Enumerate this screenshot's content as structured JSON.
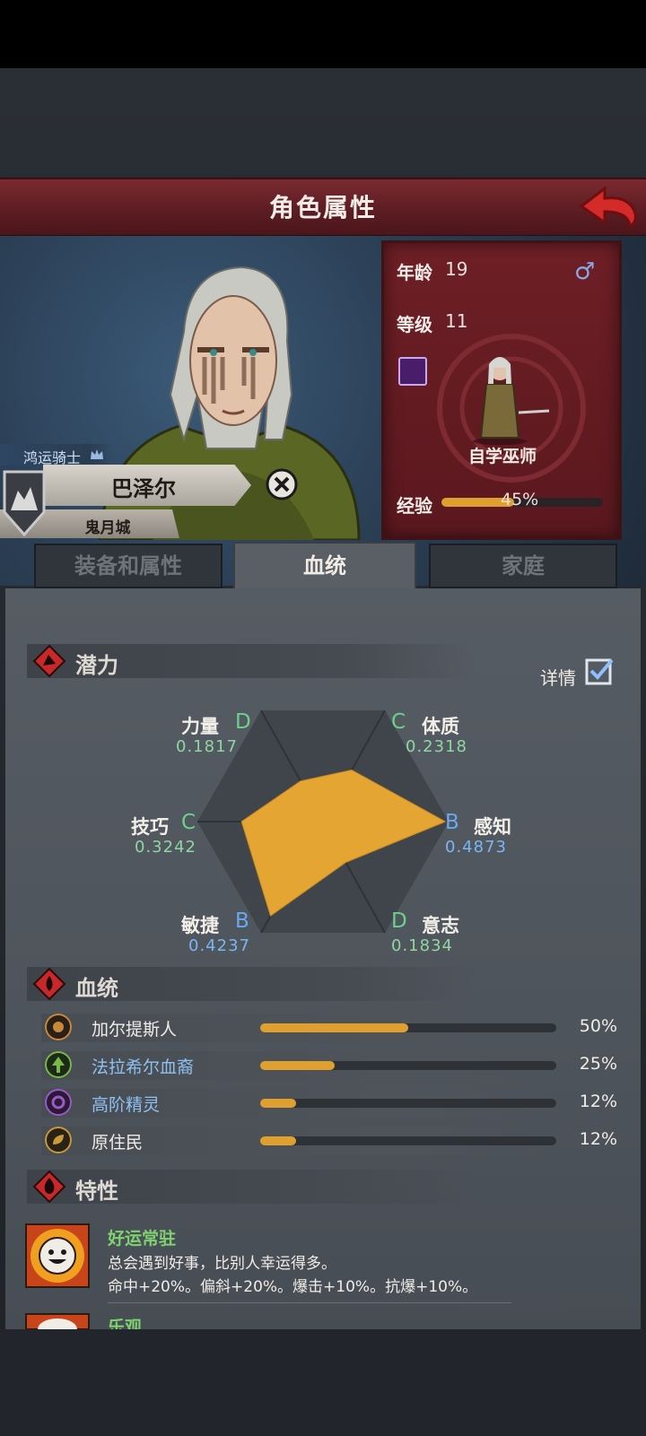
{
  "header": {
    "title": "角色属性",
    "back_icon": "red-arrow-back-icon"
  },
  "character": {
    "title": "鸿运骑士",
    "name": "巴泽尔",
    "city": "鬼月城",
    "age_label": "年龄",
    "age": "19",
    "level_label": "等级",
    "level": "11",
    "class_name": "自学巫师",
    "exp_label": "经验",
    "exp_percent": 45,
    "exp_text": "45%",
    "gender_icon": "male-icon"
  },
  "tabs": [
    {
      "label": "装备和属性",
      "active": false
    },
    {
      "label": "血统",
      "active": true
    },
    {
      "label": "家庭",
      "active": false
    }
  ],
  "potential": {
    "title": "潜力",
    "detail_label": "详情",
    "detail_checked": true,
    "attributes": [
      {
        "name": "力量",
        "grade": "D",
        "value": "0.1817"
      },
      {
        "name": "体质",
        "grade": "C",
        "value": "0.2318"
      },
      {
        "name": "感知",
        "grade": "B",
        "value": "0.4873"
      },
      {
        "name": "意志",
        "grade": "D",
        "value": "0.1834"
      },
      {
        "name": "敏捷",
        "grade": "B",
        "value": "0.4237"
      },
      {
        "name": "技巧",
        "grade": "C",
        "value": "0.3242"
      }
    ],
    "chart_data": {
      "type": "radar",
      "axes": [
        "力量",
        "体质",
        "感知",
        "意志",
        "敏捷",
        "技巧"
      ],
      "values": [
        0.1817,
        0.2318,
        0.4873,
        0.1834,
        0.4237,
        0.3242
      ],
      "max": 0.5,
      "fill_color": "#e5a533"
    }
  },
  "bloodline": {
    "title": "血统",
    "items": [
      {
        "name": "加尔提斯人",
        "percent": 50,
        "text": "50%",
        "color": "#c8893a"
      },
      {
        "name": "法拉希尔血裔",
        "percent": 25,
        "text": "25%",
        "color": "#7ab84a"
      },
      {
        "name": "高阶精灵",
        "percent": 12,
        "text": "12%",
        "color": "#9a5ac8"
      },
      {
        "name": "原住民",
        "percent": 12,
        "text": "12%",
        "color": "#c89a3a"
      }
    ]
  },
  "traits": {
    "title": "特性",
    "items": [
      {
        "name": "好运常驻",
        "desc": "总会遇到好事，比别人幸运得多。",
        "effect": "命中+20%。偏斜+20%。爆击+10%。抗爆+10%。"
      },
      {
        "name": "乐观"
      }
    ]
  }
}
